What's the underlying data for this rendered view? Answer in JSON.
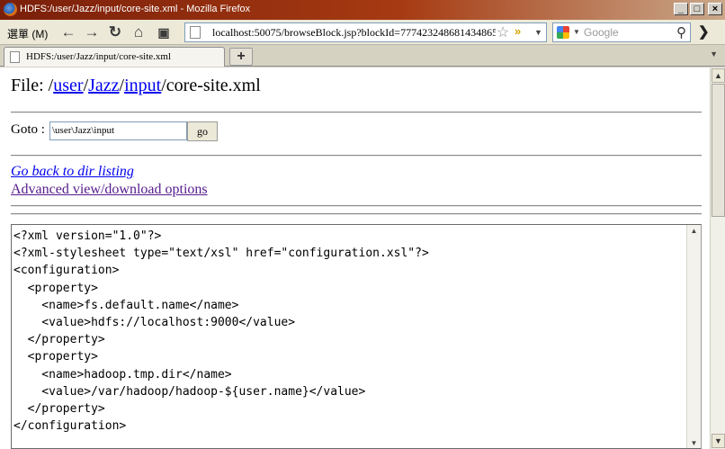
{
  "window": {
    "title": "HDFS:/user/Jazz/input/core-site.xml - Mozilla Firefox",
    "buttons": {
      "minimize": "_",
      "maximize": "□",
      "close": "×"
    }
  },
  "toolbar": {
    "menu_label": "選單 (M)",
    "url": "localhost:50075/browseBlock.jsp?blockId=777423248681434865",
    "search_placeholder": "Google"
  },
  "tabs": [
    {
      "title": "HDFS:/user/Jazz/input/core-site.xml",
      "active": true
    }
  ],
  "new_tab_label": "+",
  "page": {
    "file_prefix": "File: ",
    "path_sep": "/",
    "path_links": [
      "user",
      "Jazz",
      "input"
    ],
    "file_name": "/core-site.xml",
    "goto_label": "Goto :",
    "goto_value": "\\user\\Jazz\\input",
    "go_button": "go",
    "back_link": "Go back to dir listing",
    "advanced_link": "Advanced view/download options",
    "file_content": "<?xml version=\"1.0\"?>\n<?xml-stylesheet type=\"text/xsl\" href=\"configuration.xsl\"?>\n<configuration>\n  <property>\n    <name>fs.default.name</name>\n    <value>hdfs://localhost:9000</value>\n  </property>\n  <property>\n    <name>hadoop.tmp.dir</name>\n    <value>/var/hadoop/hadoop-${user.name}</value>\n  </property>\n</configuration>"
  }
}
